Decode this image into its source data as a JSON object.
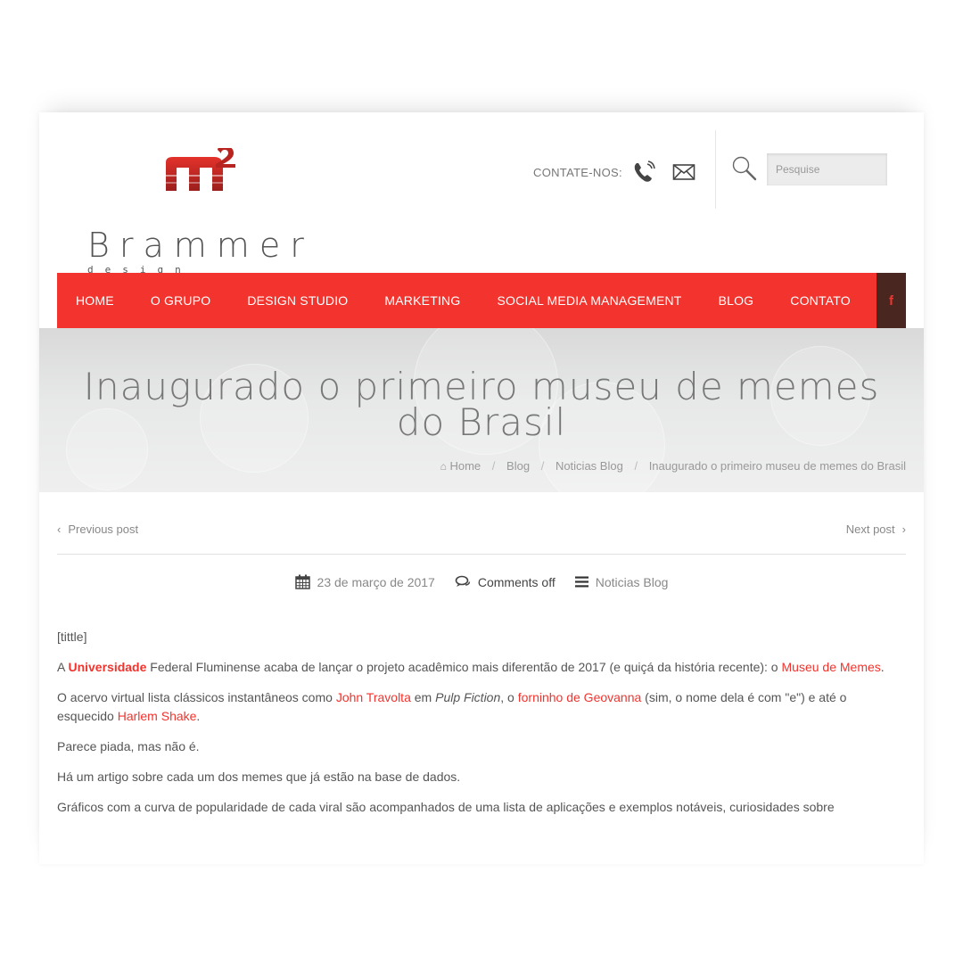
{
  "brand": {
    "name": "Brammer",
    "tagline": "design studio",
    "mark_sup": "2"
  },
  "header": {
    "contact_label": "CONTATE-NOS:",
    "search_placeholder": "Pesquise"
  },
  "nav": {
    "items": [
      "HOME",
      "O GRUPO",
      "DESIGN STUDIO",
      "MARKETING",
      "SOCIAL MEDIA MANAGEMENT",
      "BLOG",
      "CONTATO"
    ],
    "facebook_label": "f"
  },
  "hero": {
    "title_line1": "Inaugurado o primeiro museu de memes",
    "title_line2": "do Brasil",
    "breadcrumb": [
      "Home",
      "Blog",
      "Noticias Blog",
      "Inaugurado o primeiro museu de memes do Brasil"
    ],
    "sep": "/"
  },
  "post_nav": {
    "prev": "Previous post",
    "next": "Next post"
  },
  "meta": {
    "date": "23 de março de 2017",
    "comments": "Comments off",
    "category": "Noticias Blog"
  },
  "content": {
    "p0": "[tittle]",
    "p1_a": "A ",
    "p1_link1": "Universidade",
    "p1_b": " Federal Fluminense acaba de lançar o projeto acadêmico mais diferentão de 2017 (e quiçá da história recente): o ",
    "p1_link2": "Museu de Memes",
    "p1_c": ".",
    "p2_a": "O acervo virtual lista clássicos instantâneos como ",
    "p2_link1": "John Travolta",
    "p2_b": " em ",
    "p2_italic": "Pulp Fiction",
    "p2_c": ", o ",
    "p2_link2": "forninho de Geovanna",
    "p2_d": " (sim, o nome dela é com \"e\") e até o esquecido ",
    "p2_link3": "Harlem Shake",
    "p2_e": ".",
    "p3": "Parece piada, mas não é.",
    "p4": "Há um artigo sobre cada um dos memes que já estão na base de dados.",
    "p5": "Gráficos com a curva de popularidade de cada viral são acompanhados de uma lista de aplicações e exemplos notáveis, curiosidades sobre"
  },
  "colors": {
    "accent": "#f3332d",
    "fb_bg": "#4a2620"
  }
}
